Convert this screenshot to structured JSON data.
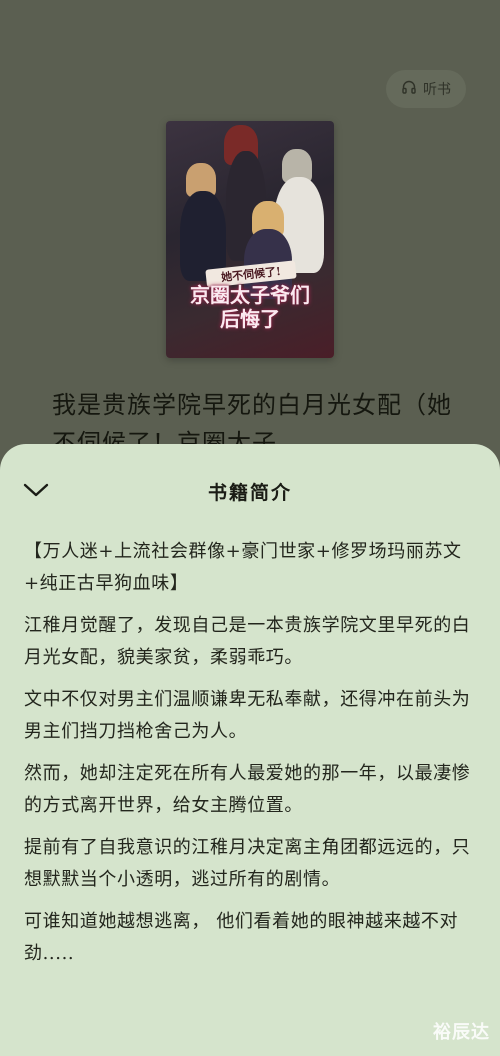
{
  "header": {
    "listen_label": "听书",
    "listen_icon": "headphones-icon"
  },
  "book": {
    "cover": {
      "badge_text": "她不伺候了!",
      "title_line1": "京圈太子爷们",
      "title_line2": "后悔了"
    },
    "title_visible": "我是贵族学院早死的白月光女配（她不伺候了！京圈太子…"
  },
  "sheet": {
    "title": "书籍简介",
    "collapse_icon": "chevron-down-icon",
    "paragraphs": [
      "【万人迷+上流社会群像+豪门世家+修罗场玛丽苏文+纯正古早狗血味】",
      "江稚月觉醒了，发现自己是一本贵族学院文里早死的白月光女配，貌美家贫，柔弱乖巧。",
      "文中不仅对男主们温顺谦卑无私奉献，还得冲在前头为男主们挡刀挡枪舍己为人。",
      "然而，她却注定死在所有人最爱她的那一年，以最凄惨的方式离开世界，给女主腾位置。",
      "提前有了自我意识的江稚月决定离主角团都远远的，只想默默当个小透明，逃过所有的剧情。",
      "可谁知道她越想逃离， 他们看着她的眼神越来越不对劲....."
    ]
  },
  "watermark": "裕辰达",
  "colors": {
    "overlay_bg": "#5b5f51",
    "sheet_bg": "#d5e4cc",
    "text": "#23261d"
  }
}
